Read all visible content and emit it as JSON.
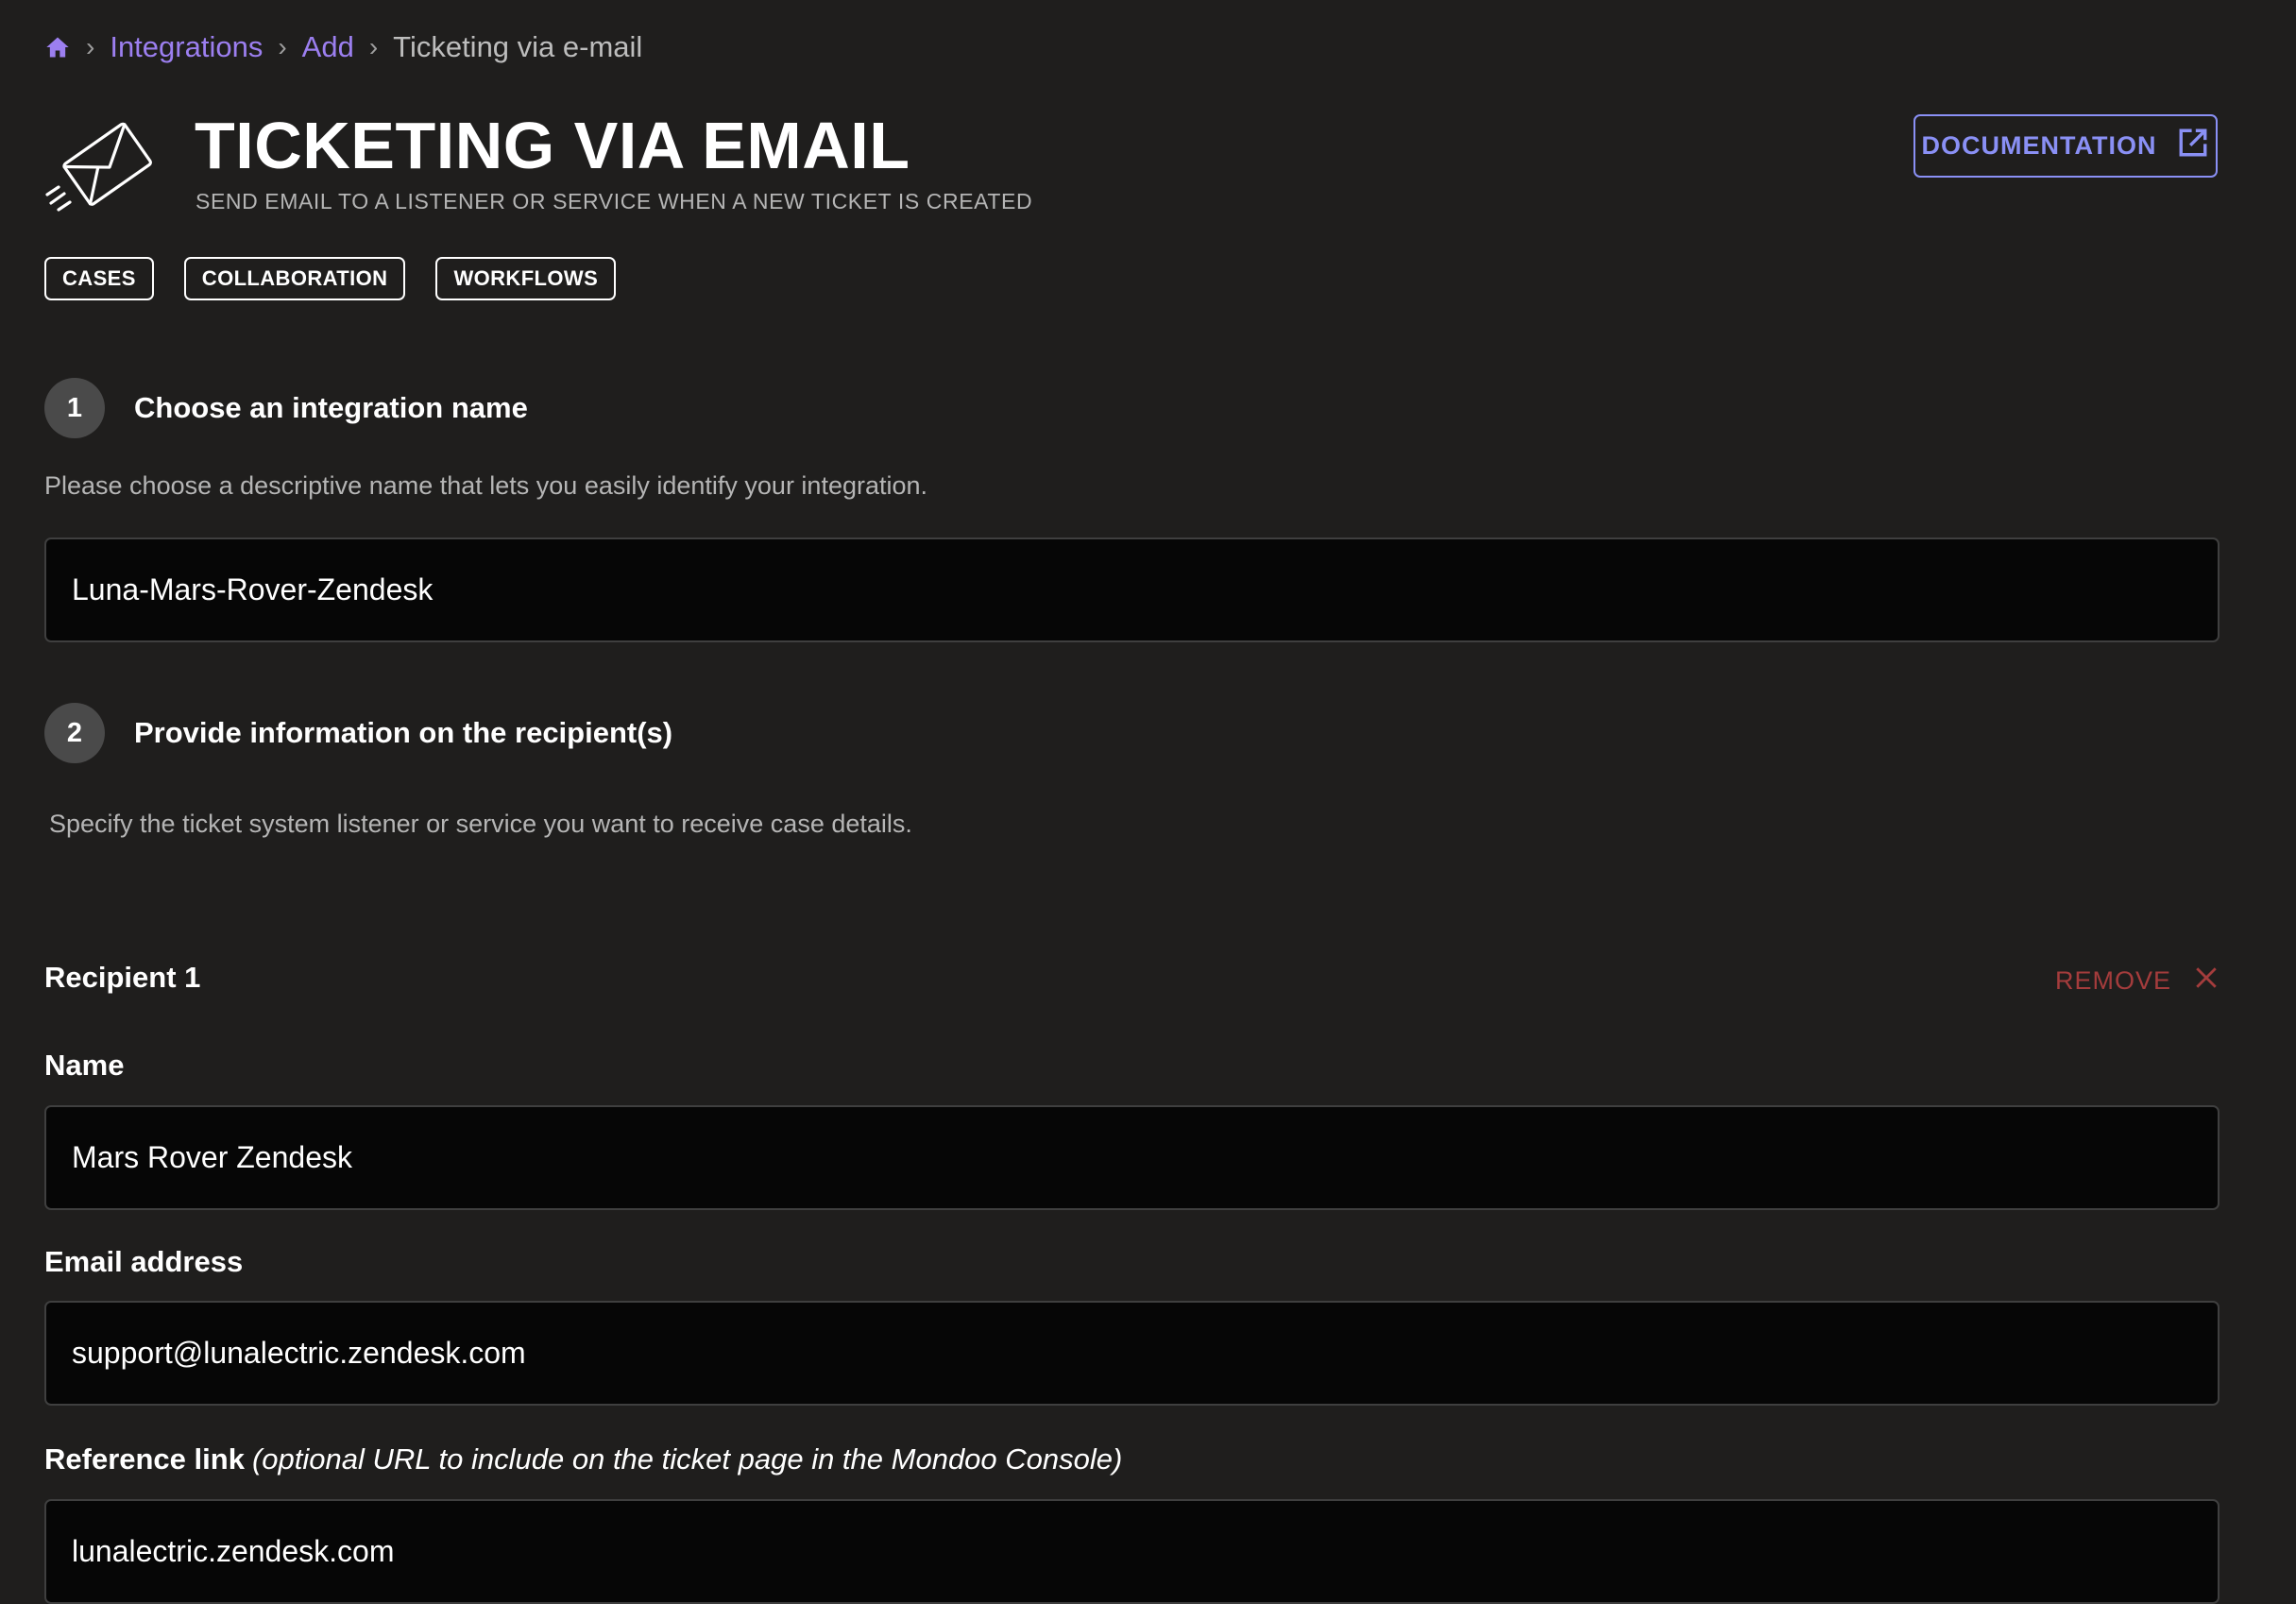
{
  "breadcrumb": {
    "home_icon": "home-icon",
    "items": [
      "Integrations",
      "Add"
    ],
    "current": "Ticketing via e-mail",
    "separator": "›"
  },
  "header": {
    "icon": "envelope-send-icon",
    "title": "TICKETING VIA EMAIL",
    "subtitle": "SEND EMAIL TO A LISTENER OR SERVICE WHEN A NEW TICKET IS CREATED",
    "documentation_label": "DOCUMENTATION",
    "documentation_icon": "external-link-icon",
    "tags": [
      "CASES",
      "COLLABORATION",
      "WORKFLOWS"
    ]
  },
  "step1": {
    "number": "1",
    "title": "Choose an integration name",
    "description": "Please choose a descriptive name that lets you easily identify your integration.",
    "integration_name_value": "Luna-Mars-Rover-Zendesk"
  },
  "step2": {
    "number": "2",
    "title": "Provide information on the recipient(s)",
    "description": "Specify the ticket system listener or service you want to receive case details."
  },
  "recipient": {
    "title": "Recipient 1",
    "remove_label": "REMOVE",
    "remove_icon": "close-icon",
    "name_label": "Name",
    "name_value": "Mars Rover Zendesk",
    "email_label": "Email address",
    "email_value": "support@lunalectric.zendesk.com",
    "reference_label": "Reference link",
    "reference_hint": "(optional URL to include on the ticket page in the Mondoo Console)",
    "reference_value": "lunalectric.zendesk.com"
  },
  "colors": {
    "background": "#1f1e1d",
    "accent_link": "#9c7ff0",
    "documentation": "#8a90f5",
    "remove": "#a43c3c",
    "input_bg": "#060606"
  }
}
